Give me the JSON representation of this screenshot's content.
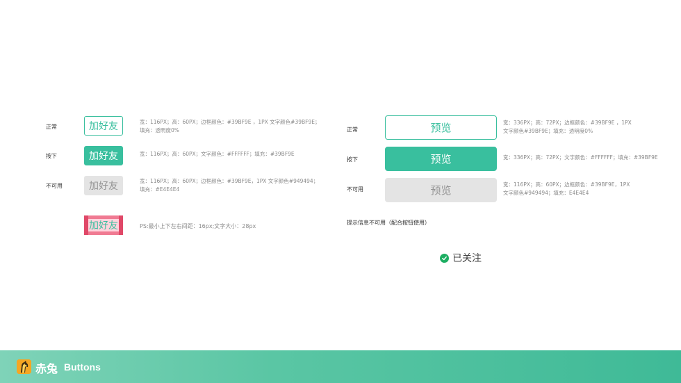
{
  "left": {
    "rows": [
      {
        "label": "正常",
        "button": "加好友",
        "spec_lines": [
          "宽：116PX；高：60PX；边框颜色：#39BF9E ，1PX  文字颜色#39BF9E；",
          "填充：透明度0%"
        ]
      },
      {
        "label": "按下",
        "button": "加好友",
        "spec_lines": [
          "宽：116PX；高：60PX；文字颜色：#FFFFFF；填充：#39BF9E"
        ]
      },
      {
        "label": "不可用",
        "button": "加好友",
        "spec_lines": [
          "宽：116PX；高：60PX；边框颜色：#39BF9E，1PX  文字颜色#949494；",
          "填充：#E4E4E4"
        ]
      }
    ],
    "padding_demo": {
      "button": "加好友",
      "note": "PS:最小上下左右间距：16px;文字大小：28px"
    }
  },
  "right": {
    "rows": [
      {
        "label": "正常",
        "button": "预览",
        "spec_lines": [
          "宽：336PX；高：72PX；边框颜色：#39BF9E ，1PX",
          "文字颜色#39BF9E；填充：透明度0%"
        ]
      },
      {
        "label": "按下",
        "button": "预览",
        "spec_lines": [
          "宽：336PX；高：72PX；文字颜色：#FFFFFF；填充：#39BF9E"
        ]
      },
      {
        "label": "不可用",
        "button": "预览",
        "spec_lines": [
          "宽：116PX；高：60PX；边框颜色：#39BF9E，1PX",
          "文字颜色#949494；填充：E4E4E4"
        ]
      }
    ],
    "hint": "提示信息不可用（配合按钮使用）",
    "followed": {
      "icon": "check-circle-icon",
      "text": "已关注"
    }
  },
  "footer": {
    "brand": "赤兔",
    "title": "Buttons",
    "logo_icon": "horse-logo-icon"
  },
  "colors": {
    "accent": "#39BF9E",
    "text_white": "#FFFFFF",
    "disabled_text": "#949494",
    "disabled_fill": "#E4E4E4",
    "success": "#1dae62"
  }
}
